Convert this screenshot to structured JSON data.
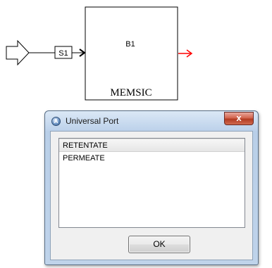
{
  "flowsheet": {
    "stream_label": "S1",
    "block_id": "B1",
    "block_name": "MEMSIC",
    "outlet_arrow_color": "#ff0000"
  },
  "dialog": {
    "title": "Universal Port",
    "app_icon": "aspen-app-icon",
    "close_label": "x",
    "items": [
      {
        "label": "RETENTATE",
        "selected": true
      },
      {
        "label": "PERMEATE",
        "selected": false
      }
    ],
    "ok_label": "OK"
  }
}
